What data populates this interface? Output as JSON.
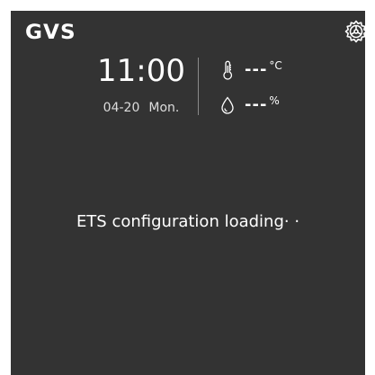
{
  "header": {
    "logo_text": "GVS",
    "settings_icon": "gear-icon"
  },
  "clock": {
    "time": "11:00",
    "date": "04-20",
    "weekday": "Mon."
  },
  "sensors": {
    "temperature": {
      "icon": "thermometer-icon",
      "value": "---",
      "unit": "°C"
    },
    "humidity": {
      "icon": "droplet-icon",
      "value": "---",
      "unit": "%"
    }
  },
  "status": {
    "message": "ETS configuration loading· ·"
  },
  "colors": {
    "panel_background": "#333333",
    "page_background": "#ffffff",
    "text": "#ffffff",
    "divider": "#8a8a8a"
  }
}
